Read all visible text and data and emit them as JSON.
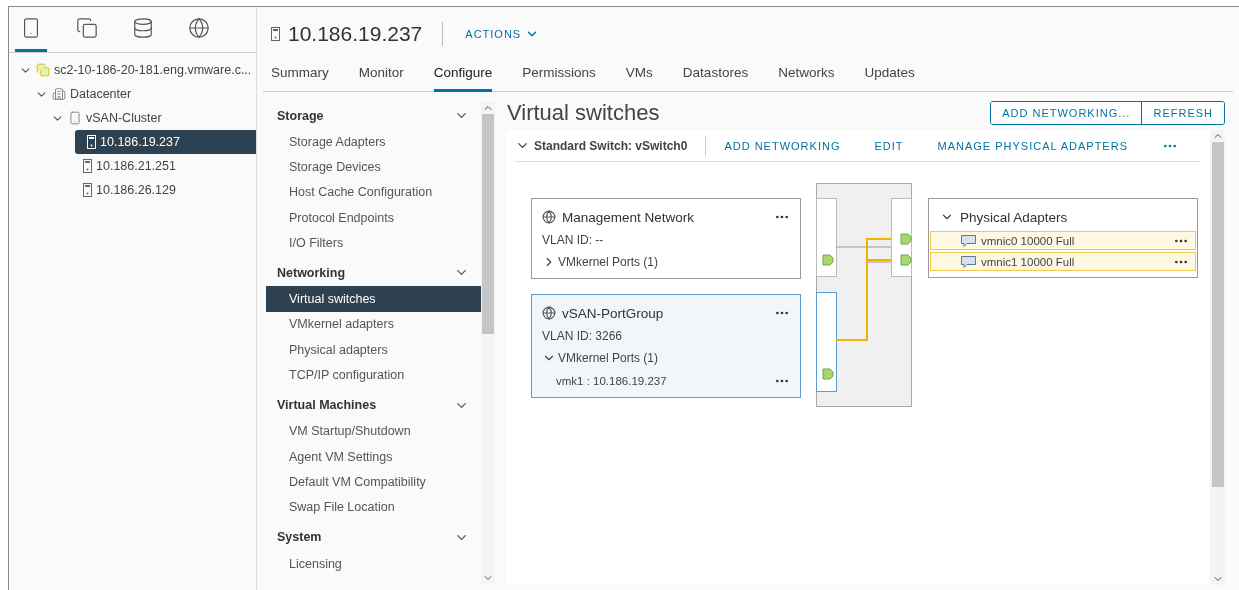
{
  "nav_tabs": [
    {
      "kind": "hosts",
      "selected": true
    },
    {
      "kind": "vms",
      "selected": false
    },
    {
      "kind": "storage",
      "selected": false
    },
    {
      "kind": "network",
      "selected": false
    }
  ],
  "tree": [
    {
      "kind": "vcenter",
      "label": "sc2-10-186-20-181.eng.vmware.c...",
      "expanded": true,
      "selected": false,
      "children": [
        {
          "kind": "datacenter",
          "label": "Datacenter",
          "expanded": true,
          "selected": false,
          "children": [
            {
              "kind": "cluster",
              "label": "vSAN-Cluster",
              "expanded": true,
              "selected": false,
              "children": [
                {
                  "kind": "host",
                  "label": "10.186.19.237",
                  "selected": true
                },
                {
                  "kind": "host",
                  "label": "10.186.21.251",
                  "selected": false
                },
                {
                  "kind": "host",
                  "label": "10.186.26.129",
                  "selected": false
                }
              ]
            }
          ]
        }
      ]
    }
  ],
  "header": {
    "title": "10.186.19.237",
    "actions": "ACTIONS"
  },
  "tabs": [
    {
      "label": "Summary",
      "selected": false
    },
    {
      "label": "Monitor",
      "selected": false
    },
    {
      "label": "Configure",
      "selected": true
    },
    {
      "label": "Permissions",
      "selected": false
    },
    {
      "label": "VMs",
      "selected": false
    },
    {
      "label": "Datastores",
      "selected": false
    },
    {
      "label": "Networks",
      "selected": false
    },
    {
      "label": "Updates",
      "selected": false
    }
  ],
  "config_menu": [
    {
      "heading": "Storage",
      "expanded": true,
      "items": [
        {
          "label": "Storage Adapters",
          "selected": false
        },
        {
          "label": "Storage Devices",
          "selected": false
        },
        {
          "label": "Host Cache Configuration",
          "selected": false
        },
        {
          "label": "Protocol Endpoints",
          "selected": false
        },
        {
          "label": "I/O Filters",
          "selected": false
        }
      ]
    },
    {
      "heading": "Networking",
      "expanded": true,
      "items": [
        {
          "label": "Virtual switches",
          "selected": true
        },
        {
          "label": "VMkernel adapters",
          "selected": false
        },
        {
          "label": "Physical adapters",
          "selected": false
        },
        {
          "label": "TCP/IP configuration",
          "selected": false
        }
      ]
    },
    {
      "heading": "Virtual Machines",
      "expanded": true,
      "items": [
        {
          "label": "VM Startup/Shutdown",
          "selected": false
        },
        {
          "label": "Agent VM Settings",
          "selected": false
        },
        {
          "label": "Default VM Compatibility",
          "selected": false
        },
        {
          "label": "Swap File Location",
          "selected": false
        }
      ]
    },
    {
      "heading": "System",
      "expanded": true,
      "items": [
        {
          "label": "Licensing",
          "selected": false
        }
      ]
    }
  ],
  "page_title": "Virtual switches",
  "buttons": [
    "ADD NETWORKING...",
    "REFRESH"
  ],
  "switch": {
    "title": "Standard Switch: vSwitch0",
    "expanded": true,
    "actions": [
      "ADD NETWORKING",
      "EDIT",
      "MANAGE PHYSICAL ADAPTERS"
    ]
  },
  "port_groups": [
    {
      "name": "Management Network",
      "vlan": "VLAN ID: --",
      "ports_label": "VMkernel Ports (1)",
      "expanded": false,
      "selected": false
    },
    {
      "name": "vSAN-PortGroup",
      "vlan": "VLAN ID: 3266",
      "ports_label": "VMkernel Ports (1)",
      "expanded": true,
      "selected": true,
      "ports": [
        "vmk1 : 10.186.19.237"
      ]
    }
  ],
  "physical_adapters": {
    "title": "Physical Adapters",
    "expanded": true,
    "items": [
      "vmnic0 10000 Full",
      "vmnic1 10000 Full"
    ]
  }
}
